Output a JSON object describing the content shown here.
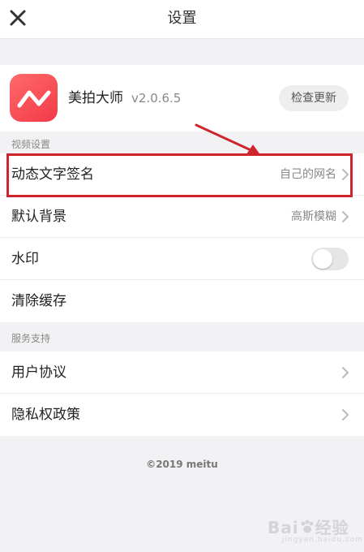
{
  "header": {
    "title": "设置"
  },
  "app": {
    "name": "美拍大师",
    "version": "v2.0.6.5",
    "check_update_label": "检查更新"
  },
  "video_section": {
    "label": "视频设置",
    "items": [
      {
        "label": "动态文字签名",
        "value": "自己的网名"
      },
      {
        "label": "默认背景",
        "value": "高斯模糊"
      },
      {
        "label": "水印",
        "toggle_on": false
      },
      {
        "label": "清除缓存"
      }
    ]
  },
  "service_section": {
    "label": "服务支持",
    "items": [
      {
        "label": "用户协议"
      },
      {
        "label": "隐私权政策"
      }
    ]
  },
  "footer": {
    "copyright": "©2019 meitu"
  },
  "annotation": {
    "highlight_color": "#d0242c"
  },
  "watermark": {
    "brand": "Bai",
    "suffix": "经验",
    "sub": "jingyan.baidu.com"
  },
  "colors": {
    "logo_red": "#f23a48",
    "background": "#f2f2f4"
  }
}
